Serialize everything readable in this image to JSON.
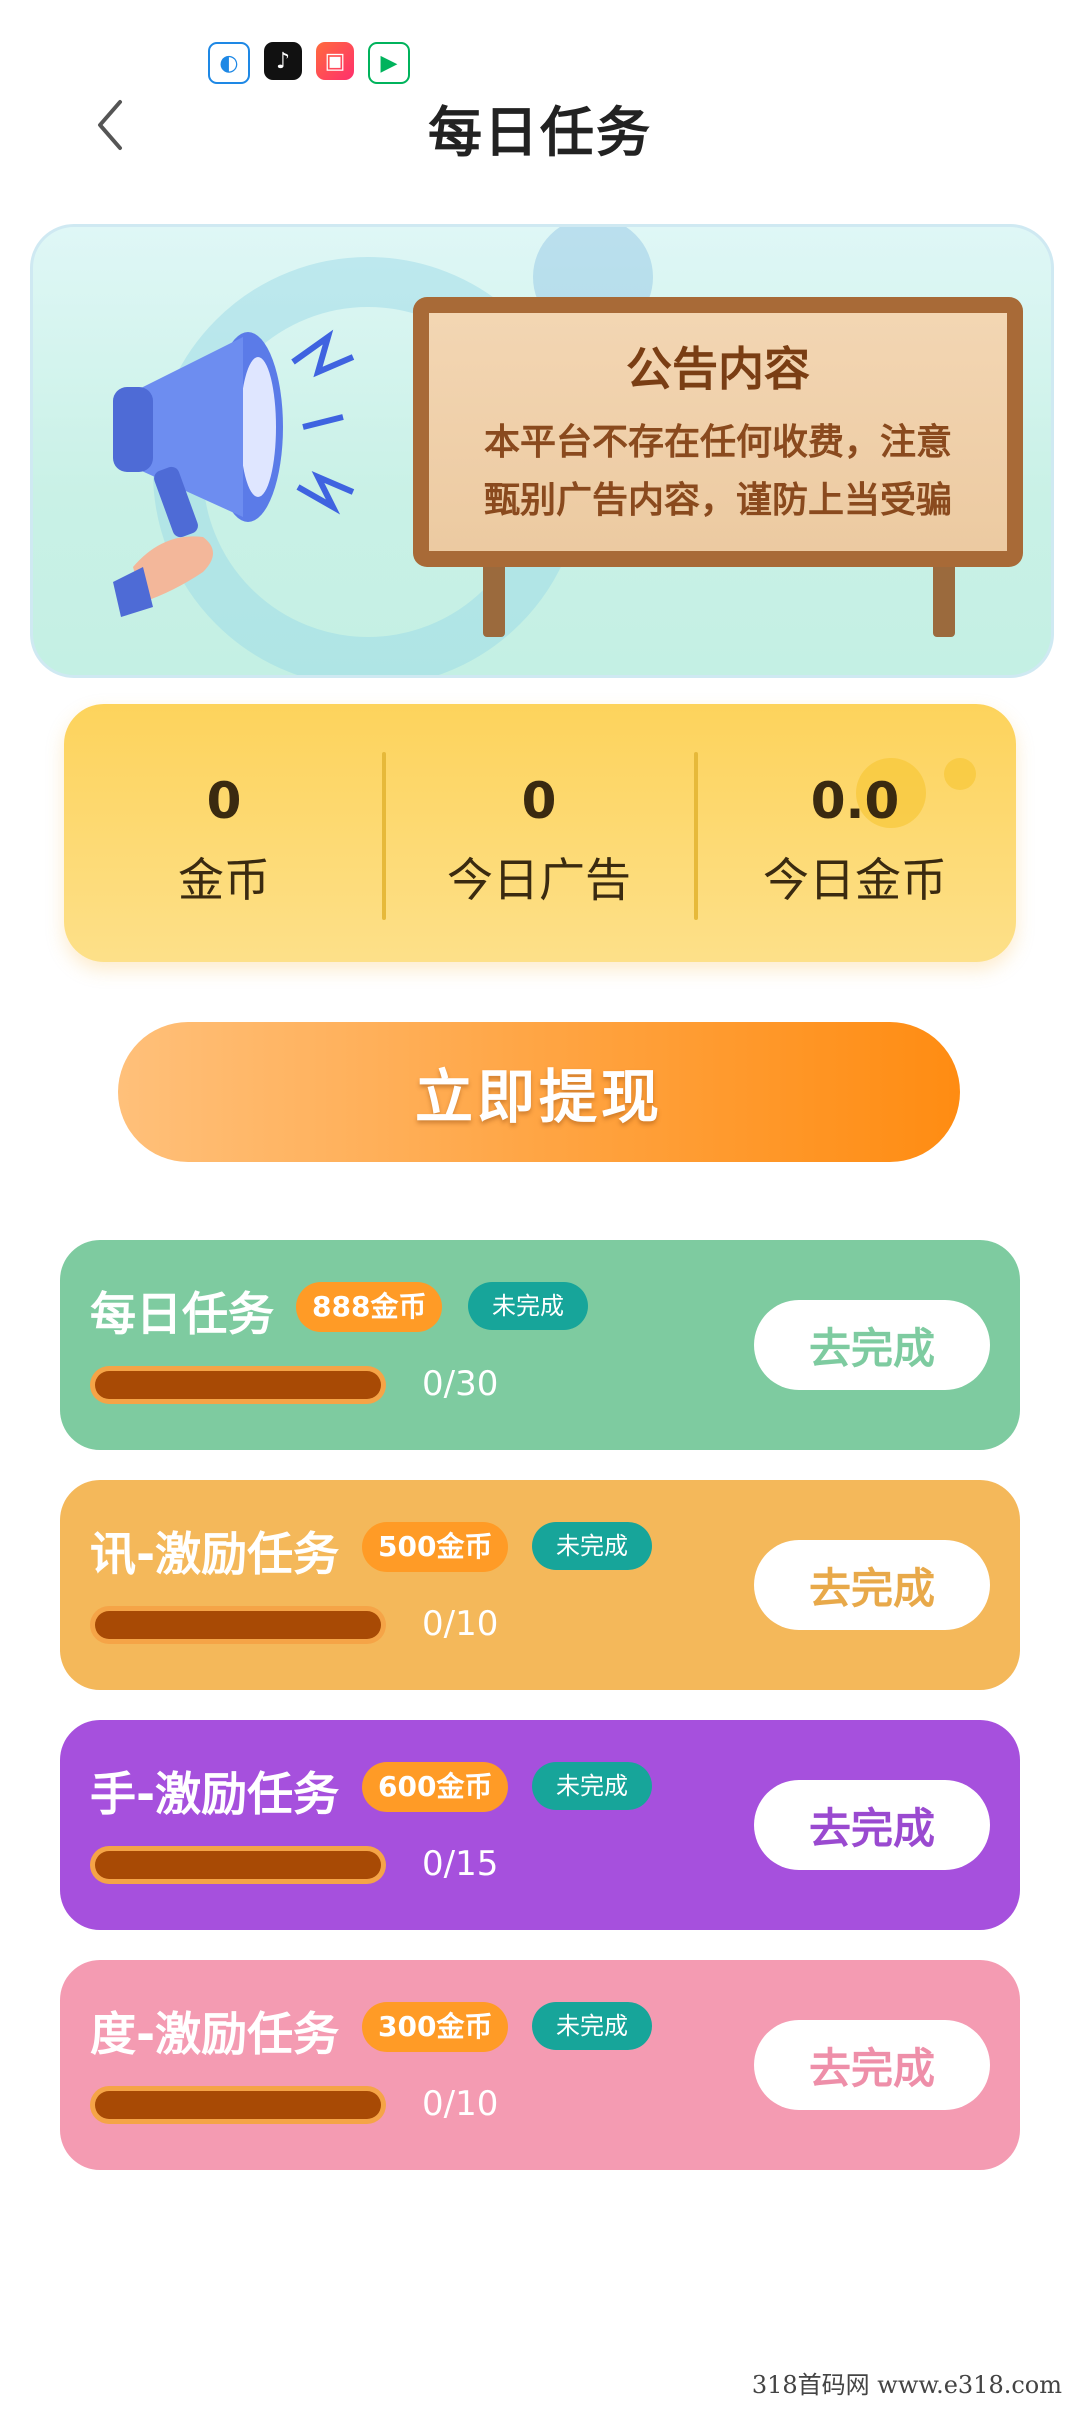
{
  "status_bar": {
    "app_icons": [
      "browser-app-icon",
      "tiktok-icon",
      "photo-app-icon",
      "video-app-icon"
    ]
  },
  "header": {
    "title": "每日任务",
    "back_icon": "chevron-left-icon"
  },
  "notice": {
    "title": "公告内容",
    "line1": "本平台不存在任何收费，注意",
    "line2": "甄别广告内容，谨防上当受骗"
  },
  "stats": [
    {
      "value": "0",
      "label": "金币"
    },
    {
      "value": "0",
      "label": "今日广告"
    },
    {
      "value": "0.0",
      "label": "今日金币"
    }
  ],
  "withdraw_button": "立即提现",
  "tasks": [
    {
      "name": "每日任务",
      "coins": "888金币",
      "status": "未完成",
      "progress": "0/30",
      "action": "去完成",
      "color": "#7ecba0",
      "action_color": "#7ecba0"
    },
    {
      "name": "讯-激励任务",
      "coins": "500金币",
      "status": "未完成",
      "progress": "0/10",
      "action": "去完成",
      "color": "#f4b85a",
      "action_color": "#e8a94a"
    },
    {
      "name": "手-激励任务",
      "coins": "600金币",
      "status": "未完成",
      "progress": "0/15",
      "action": "去完成",
      "color": "#a650dd",
      "action_color": "#9a4ad0"
    },
    {
      "name": "度-激励任务",
      "coins": "300金币",
      "status": "未完成",
      "progress": "0/10",
      "action": "去完成",
      "color": "#f49bb2",
      "action_color": "#ee8fa9"
    }
  ],
  "watermark": "318首码网  www.e318.com"
}
